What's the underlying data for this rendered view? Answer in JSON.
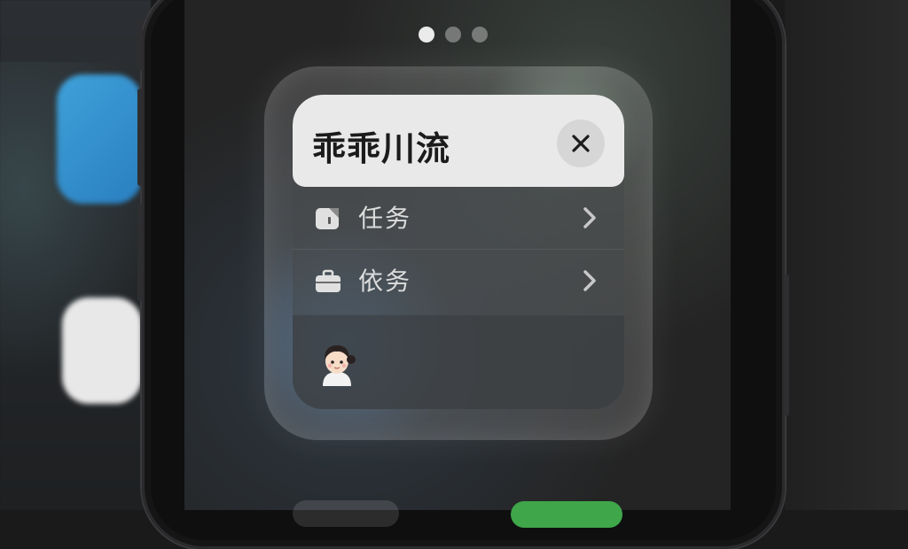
{
  "widget": {
    "title": "乖乖川流",
    "items": [
      {
        "label": "任务",
        "icon": "note-icon"
      },
      {
        "label": "依务",
        "icon": "briefcase-icon"
      }
    ],
    "close_icon": "close-icon",
    "avatar": "girl-avatar-icon"
  },
  "page_indicator": {
    "count": 3,
    "active": 0
  },
  "colors": {
    "header_bg": "#e9e9e9",
    "dock_green": "#3fa64a"
  }
}
